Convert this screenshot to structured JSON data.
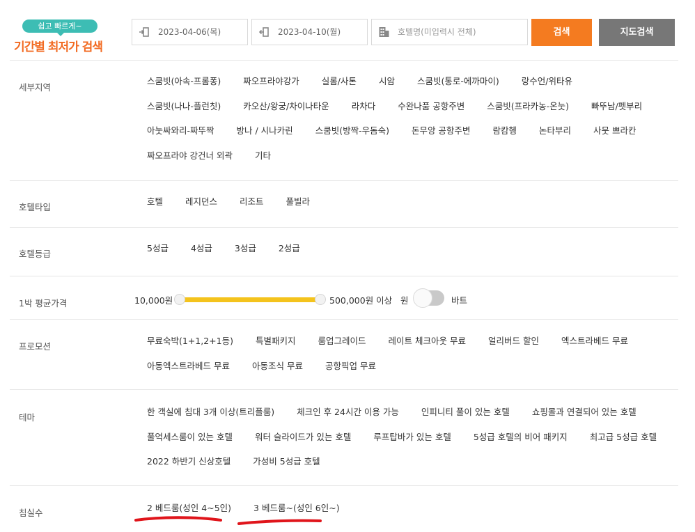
{
  "search": {
    "promo_bubble": "쉽고 빠르게~",
    "promo_title": "기간별 최저가 검색",
    "checkin": "2023-04-06(목)",
    "checkout": "2023-04-10(월)",
    "hotel_placeholder": "호텔명(미입력시 전체)",
    "search_button": "검색",
    "map_button": "지도검색",
    "accent_color": "#f47b20",
    "icons": [
      "checkin-icon",
      "checkout-icon",
      "building-icon"
    ]
  },
  "filters": {
    "region": {
      "label": "세부지역",
      "lines": [
        [
          "스쿰빗(아속-프롬퐁)",
          "짜오프라야강가",
          "실롬/사톤",
          "시암",
          "스쿰빗(통로-에까마이)",
          "랑수언/위타유"
        ],
        [
          "스쿰빗(나나-플런칫)",
          "카오산/왕궁/차이나타운",
          "라차다",
          "수완나품 공항주변",
          "스쿰빗(프라카농-온눗)",
          "빠뚜남/펫부리"
        ],
        [
          "아눗싸와리-짜뚜짝",
          "방나 / 시나카린",
          "스쿰빗(방짝-우돔숙)",
          "돈무앙 공항주변",
          "람캄헹",
          "논타부리",
          "사뭇 쁘라칸"
        ],
        [
          "짜오프라야 강건너 외곽",
          "기타"
        ]
      ]
    },
    "hotel_type": {
      "label": "호텔타입",
      "lines": [
        [
          "호텔",
          "레지던스",
          "리조트",
          "풀빌라"
        ]
      ]
    },
    "hotel_grade": {
      "label": "호텔등급",
      "lines": [
        [
          "5성급",
          "4성급",
          "3성급",
          "2성급"
        ]
      ]
    },
    "price": {
      "label": "1박 평균가격",
      "min_label": "10,000원",
      "max_label": "500,000원 이상",
      "currency_won": "원",
      "currency_baht": "바트",
      "slider_color": "#f4c31d"
    },
    "promotion": {
      "label": "프로모션",
      "lines": [
        [
          "무료숙박(1+1,2+1등)",
          "특별패키지",
          "룸업그레이드",
          "레이트 체크아웃 무료",
          "얼리버드 할인",
          "엑스트라베드 무료"
        ],
        [
          "아동엑스트라베드 무료",
          "아동조식 무료",
          "공항픽업 무료"
        ]
      ]
    },
    "theme": {
      "label": "테마",
      "lines": [
        [
          "한 객실에 침대 3개 이상(트리플룸)",
          "체크인 후 24시간 이용 가능",
          "인피니티 풀이 있는 호텔",
          "쇼핑몰과 연결되어 있는 호텔"
        ],
        [
          "풀억세스룸이 있는 호텔",
          "워터 슬라이드가 있는 호텔",
          "루프탑바가 있는 호텔",
          "5성급 호텔의 비어 패키지",
          "최고급 5성급 호텔"
        ],
        [
          "2022 하반기 신상호텔",
          "가성비 5성급 호텔"
        ]
      ]
    },
    "bedrooms": {
      "label": "침실수",
      "lines": [
        [
          "2 베드룸(성인 4~5인)",
          "3 베드룸~(성인 6인~)"
        ]
      ],
      "highlight_color": "#e0151b"
    }
  }
}
